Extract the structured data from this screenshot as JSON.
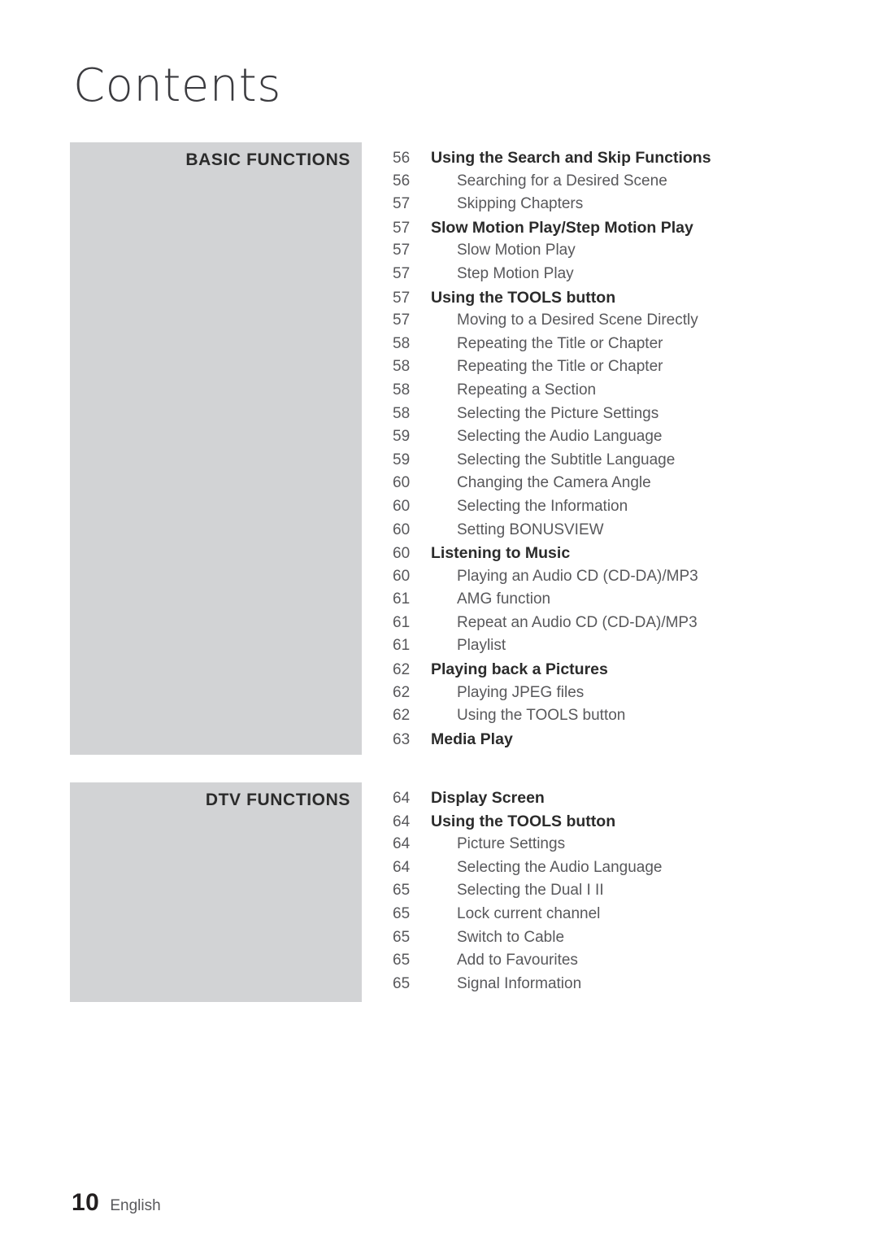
{
  "page": {
    "title": "Contents",
    "footer": {
      "page_number": "10",
      "language": "English"
    },
    "accent_panel_color": "#d2d3d5",
    "heading_color": "#2b2b2b",
    "body_color": "#58585b"
  },
  "sections": [
    {
      "panel_label": "BASIC FUNCTIONS",
      "entries": [
        {
          "page": "56",
          "label": "Using the Search and Skip Functions",
          "level": 1
        },
        {
          "page": "56",
          "label": "Searching for a Desired Scene",
          "level": 2
        },
        {
          "page": "57",
          "label": "Skipping Chapters",
          "level": 2
        },
        {
          "page": "57",
          "label": "Slow Motion Play/Step Motion Play",
          "level": 1
        },
        {
          "page": "57",
          "label": "Slow Motion Play",
          "level": 2
        },
        {
          "page": "57",
          "label": "Step Motion Play",
          "level": 2
        },
        {
          "page": "57",
          "label": "Using the TOOLS button",
          "level": 1
        },
        {
          "page": "57",
          "label": "Moving to a Desired Scene Directly",
          "level": 2
        },
        {
          "page": "58",
          "label": "Repeating the Title or Chapter",
          "level": 2
        },
        {
          "page": "58",
          "label": "Repeating the Title or Chapter",
          "level": 2
        },
        {
          "page": "58",
          "label": "Repeating a Section",
          "level": 2
        },
        {
          "page": "58",
          "label": "Selecting the Picture Settings",
          "level": 2
        },
        {
          "page": "59",
          "label": "Selecting the Audio Language",
          "level": 2
        },
        {
          "page": "59",
          "label": "Selecting the Subtitle Language",
          "level": 2
        },
        {
          "page": "60",
          "label": "Changing the Camera Angle",
          "level": 2
        },
        {
          "page": "60",
          "label": "Selecting the Information",
          "level": 2
        },
        {
          "page": "60",
          "label": "Setting BONUSVIEW",
          "level": 2
        },
        {
          "page": "60",
          "label": "Listening to Music",
          "level": 1
        },
        {
          "page": "60",
          "label": "Playing an Audio CD (CD-DA)/MP3",
          "level": 2
        },
        {
          "page": "61",
          "label": "AMG function",
          "level": 2
        },
        {
          "page": "61",
          "label": "Repeat an Audio CD (CD-DA)/MP3",
          "level": 2
        },
        {
          "page": "61",
          "label": "Playlist",
          "level": 2
        },
        {
          "page": "62",
          "label": "Playing back a Pictures",
          "level": 1
        },
        {
          "page": "62",
          "label": "Playing JPEG files",
          "level": 2
        },
        {
          "page": "62",
          "label": "Using the TOOLS button",
          "level": 2
        },
        {
          "page": "63",
          "label": "Media Play",
          "level": 1
        }
      ]
    },
    {
      "panel_label": "DTV FUNCTIONS",
      "entries": [
        {
          "page": "64",
          "label": "Display Screen",
          "level": 1
        },
        {
          "page": "64",
          "label": "Using the TOOLS button",
          "level": 1
        },
        {
          "page": "64",
          "label": "Picture Settings",
          "level": 2
        },
        {
          "page": "64",
          "label": "Selecting the Audio Language",
          "level": 2
        },
        {
          "page": "65",
          "label": "Selecting the Dual I II",
          "level": 2
        },
        {
          "page": "65",
          "label": "Lock current channel",
          "level": 2
        },
        {
          "page": "65",
          "label": "Switch to Cable",
          "level": 2
        },
        {
          "page": "65",
          "label": "Add to Favourites",
          "level": 2
        },
        {
          "page": "65",
          "label": "Signal Information",
          "level": 2
        }
      ]
    }
  ]
}
